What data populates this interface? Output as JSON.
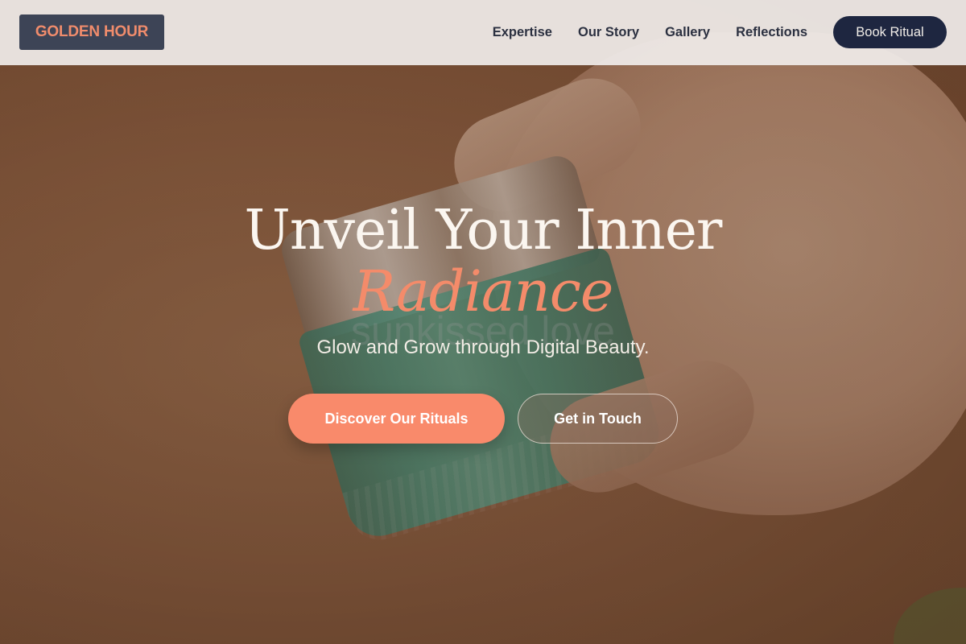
{
  "header": {
    "logo": "GOLDEN HOUR",
    "nav": [
      "Expertise",
      "Our Story",
      "Gallery",
      "Reflections"
    ],
    "cta": "Book Ritual"
  },
  "hero": {
    "headline": "Unveil Your Inner",
    "headline_accent": "Radiance",
    "ghost_text": "sunkissed love",
    "tagline": "Glow and Grow through Digital Beauty.",
    "primary_button": "Discover Our Rituals",
    "secondary_button": "Get in Touch"
  },
  "colors": {
    "accent": "#f98a6b",
    "logo_bg": "#3d4456",
    "nav_text": "#2b3040",
    "button_dark": "#1e2640",
    "header_bg": "#f0ece9"
  }
}
